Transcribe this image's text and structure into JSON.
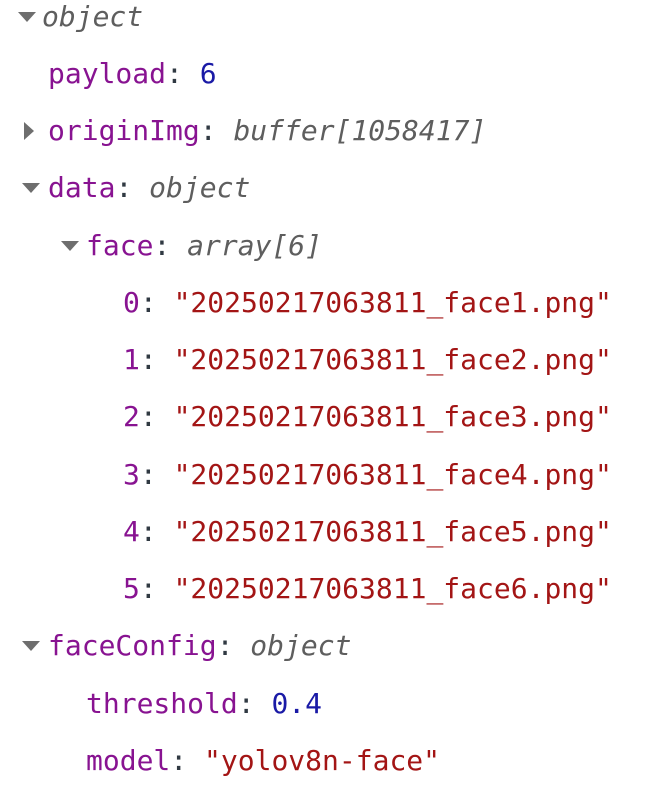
{
  "root": {
    "type": "object"
  },
  "payload": {
    "key": "payload",
    "value": "6"
  },
  "originImg": {
    "key": "originImg",
    "type": "buffer[1058417]"
  },
  "data": {
    "key": "data",
    "type": "object",
    "face": {
      "key": "face",
      "type": "array[6]",
      "items": [
        {
          "index": "0",
          "value": "\"20250217063811_face1.png\""
        },
        {
          "index": "1",
          "value": "\"20250217063811_face2.png\""
        },
        {
          "index": "2",
          "value": "\"20250217063811_face3.png\""
        },
        {
          "index": "3",
          "value": "\"20250217063811_face4.png\""
        },
        {
          "index": "4",
          "value": "\"20250217063811_face5.png\""
        },
        {
          "index": "5",
          "value": "\"20250217063811_face6.png\""
        }
      ]
    },
    "faceConfig": {
      "key": "faceConfig",
      "type": "object",
      "threshold": {
        "key": "threshold",
        "value": "0.4"
      },
      "model": {
        "key": "model",
        "value": "\"yolov8n-face\""
      }
    }
  },
  "colors": {
    "key": "#881391",
    "number": "#1a1aa6",
    "string": "#a31515",
    "type": "#5e5e5e",
    "arrow": "#6e6e6e"
  }
}
